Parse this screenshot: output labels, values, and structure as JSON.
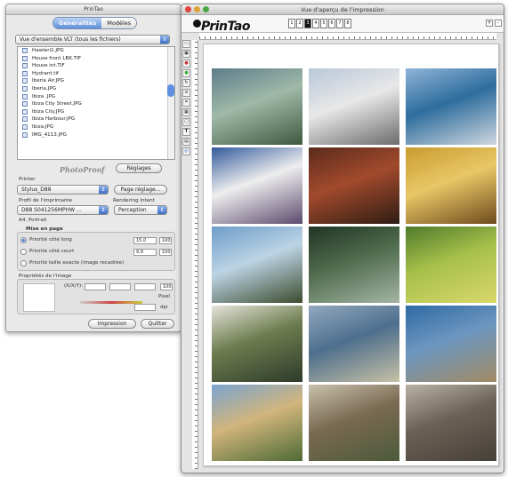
{
  "palette": {
    "title": "PrinTao",
    "tabs": [
      {
        "label": "Généralités",
        "active": true
      },
      {
        "label": "Modèles",
        "active": false
      }
    ],
    "view_select": "Vue d'ensemble VLT (tous les fichiers)",
    "files": [
      "Hawleri2.JPG",
      "House front LBK.TIF",
      "House int.TIF",
      "Hydrant.tif",
      "Iberia Air.JPG",
      "Iberia.JPG",
      "Ibiza .JPG",
      "Ibiza City Street.JPG",
      "Ibiza City.JPG",
      "Ibiza Harbour.JPG",
      "Ibiza.JPG",
      "IMG_4113.JPG"
    ],
    "brand_logo": "PhotoProof",
    "settings_button": "Réglages",
    "printer_label": "Printer",
    "printer_value": "Stylus_D88",
    "page_setup_button": "Page réglage...",
    "profile_label": "Profil de l'imprimante",
    "profile_value": "D88 S041256MPHW ...",
    "rendering_label": "Rendering Intent",
    "rendering_value": "Perception",
    "paper_info": "A4, Portrait",
    "layout_section": "Mise en page",
    "options": [
      {
        "label": "Priorité côté long",
        "value": "15.0",
        "unit": "100",
        "selected": true
      },
      {
        "label": "Priorité côté court",
        "value": "9.9",
        "unit": "100",
        "selected": false
      },
      {
        "label": "Priorité taille exacte (image recadrée)",
        "selected": false
      }
    ],
    "image_props_section": "Propriétés de l'image",
    "xy_label": "(X/X/Y):",
    "field_units": [
      "100",
      "Pixel",
      "dpi"
    ],
    "print_button": "Impression",
    "quit_button": "Quitter"
  },
  "preview": {
    "title": "Vue d'aperçu de l'impression",
    "brand": "PrinTao",
    "pages": [
      "1",
      "2",
      "3",
      "4",
      "5",
      "6",
      "7",
      "8"
    ],
    "current_page": 3,
    "photos": [
      {
        "name": "agave plant",
        "colors": [
          "#5d7c8a",
          "#9fb9a8",
          "#3d5a3f"
        ]
      },
      {
        "name": "airplane on tarmac",
        "colors": [
          "#b9c7d8",
          "#e8e8e8",
          "#6b6b6b"
        ]
      },
      {
        "name": "seaplane on water",
        "colors": [
          "#8fb4d8",
          "#2e6d9d",
          "#cfd7df"
        ]
      },
      {
        "name": "airliner on runway",
        "colors": [
          "#335a9c",
          "#eeeeee",
          "#5c4b6e"
        ]
      },
      {
        "name": "red doors facade",
        "colors": [
          "#5b2b1c",
          "#a24a2c",
          "#2e1c14"
        ]
      },
      {
        "name": "yellow archway",
        "colors": [
          "#c99b2f",
          "#e9c766",
          "#6e4b1d"
        ]
      },
      {
        "name": "coastline with lighthouse",
        "colors": [
          "#6d9dc9",
          "#bcd3e4",
          "#3b4c2e"
        ]
      },
      {
        "name": "tree silhouette",
        "colors": [
          "#203524",
          "#4f6b4c",
          "#a3b5a4"
        ]
      },
      {
        "name": "lemon tree",
        "colors": [
          "#4f7b2c",
          "#a7c04a",
          "#d9d86a"
        ]
      },
      {
        "name": "Cala Llonca sign",
        "colors": [
          "#e6e3da",
          "#6c7c4e",
          "#2e3a2a"
        ]
      },
      {
        "name": "harbour village",
        "colors": [
          "#92a8bf",
          "#4e6f8d",
          "#c7c0a5"
        ]
      },
      {
        "name": "sea cliffs",
        "colors": [
          "#2f6aa3",
          "#6c96c0",
          "#a18b63"
        ]
      },
      {
        "name": "house with palm",
        "colors": [
          "#7ba4d0",
          "#d1b57c",
          "#4e6a35"
        ]
      },
      {
        "name": "village street",
        "colors": [
          "#c9c1ad",
          "#7a6a52",
          "#4c5a3a"
        ]
      },
      {
        "name": "stone gate",
        "colors": [
          "#b8b2a3",
          "#6b6256",
          "#474038"
        ]
      }
    ]
  }
}
